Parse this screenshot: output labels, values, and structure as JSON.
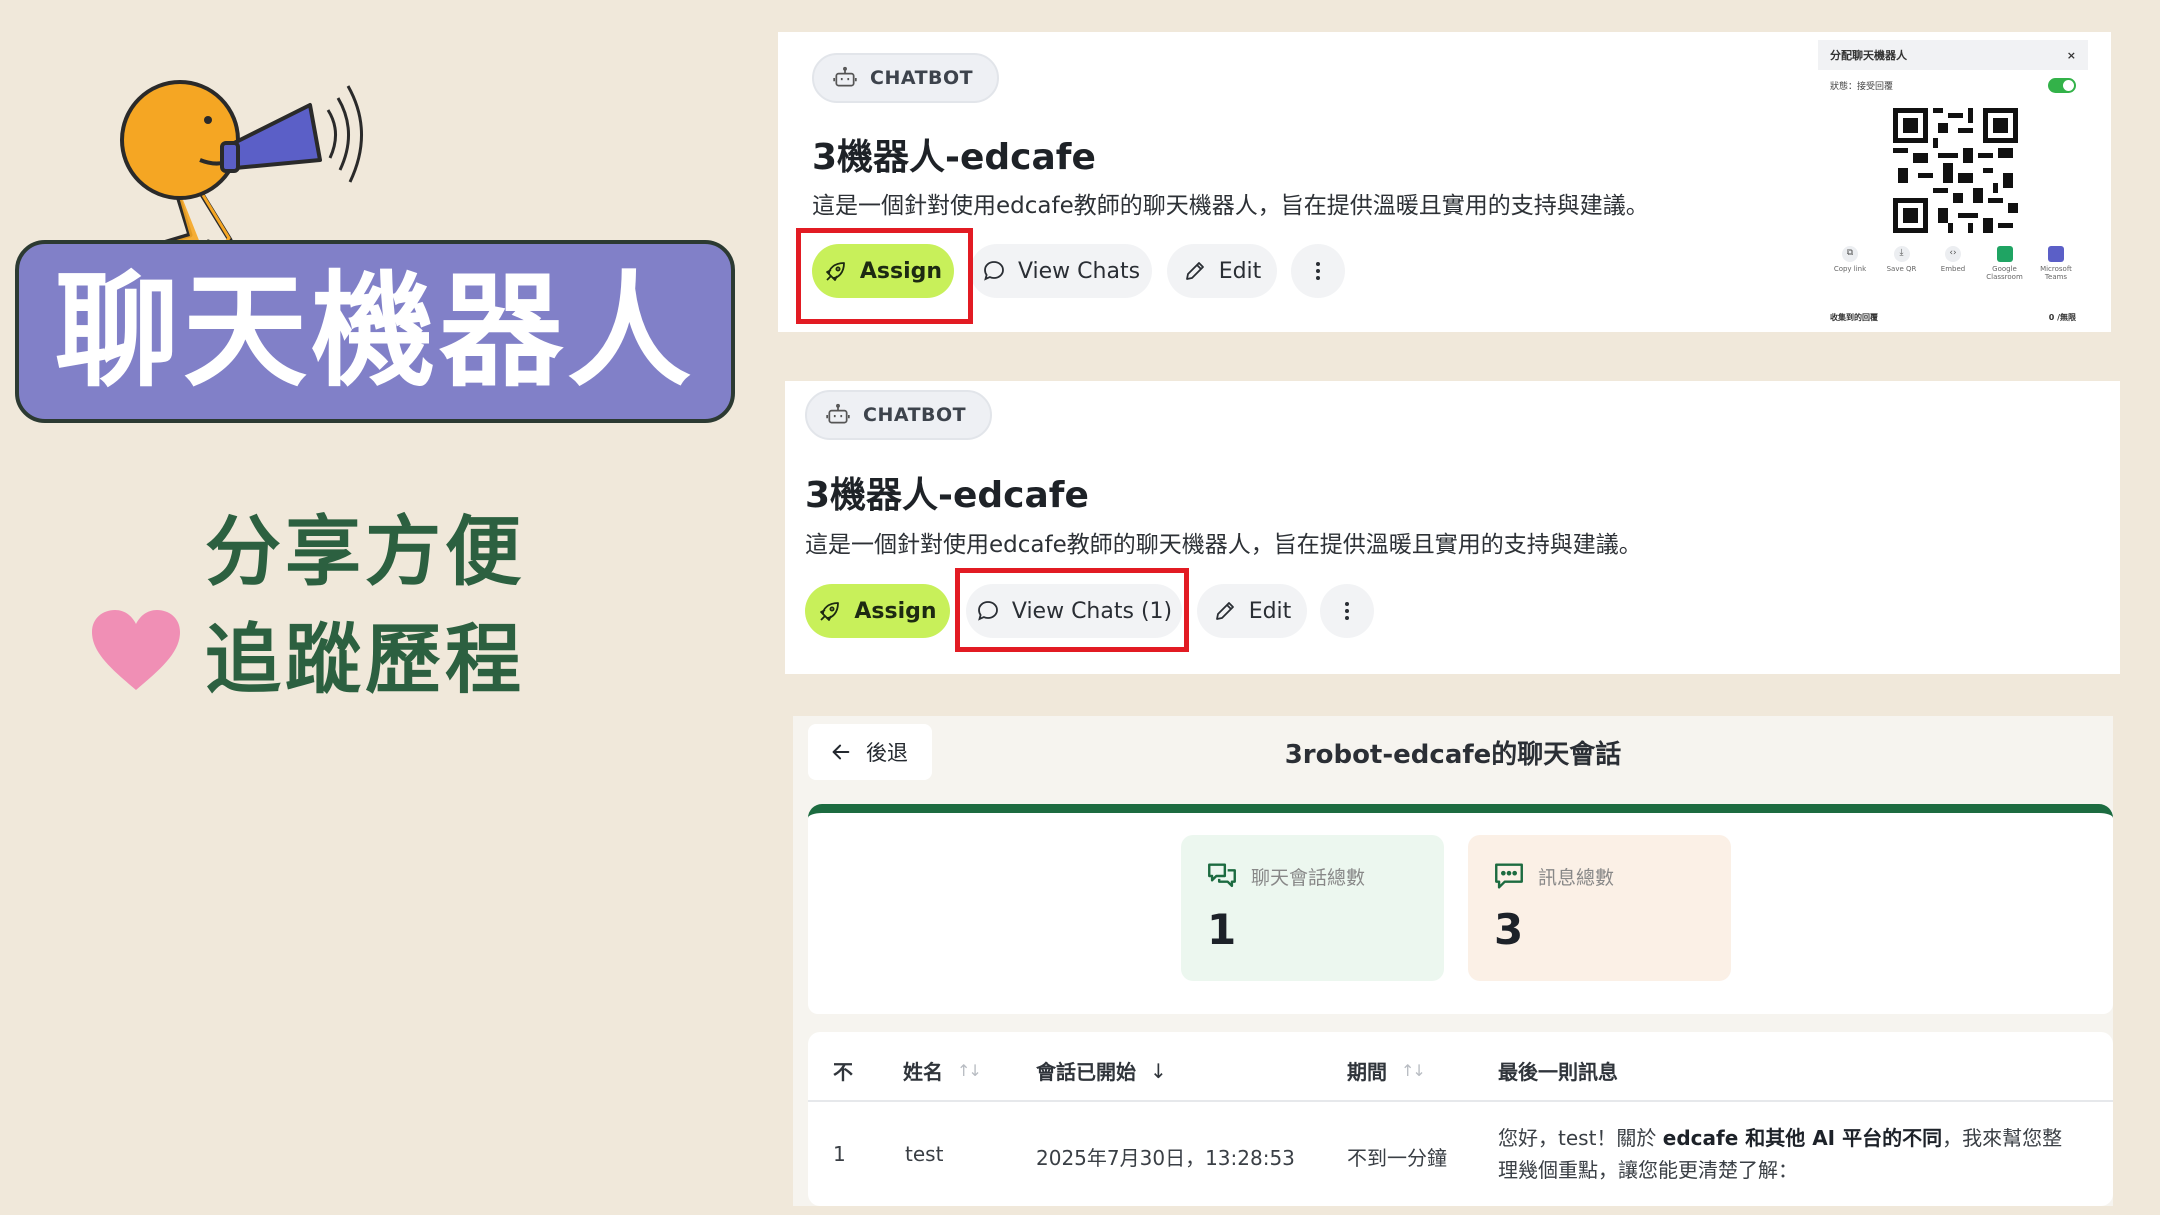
{
  "left": {
    "title": "聊天機器人",
    "features": [
      "分享方便",
      "追蹤歷程"
    ]
  },
  "panel1": {
    "chip_label": "CHATBOT",
    "bot_name": "3機器人-edcafe",
    "description": "這是一個針對使用edcafe教師的聊天機器人，旨在提供溫暖且實用的支持與建議。",
    "buttons": {
      "assign": "Assign",
      "view_chats": "View Chats",
      "edit": "Edit"
    },
    "share_dialog": {
      "title": "分配聊天機器人",
      "close": "×",
      "status_label": "狀態：接受回覆",
      "icons": [
        {
          "label": "Copy link",
          "icon": "link-icon"
        },
        {
          "label": "Save QR",
          "icon": "download-icon"
        },
        {
          "label": "Embed",
          "icon": "code-icon"
        },
        {
          "label": "Google Classroom",
          "icon": "google-classroom-icon"
        },
        {
          "label": "Microsoft Teams",
          "icon": "teams-icon"
        }
      ],
      "footer_left": "收集到的回覆",
      "footer_right": "0 /無限"
    }
  },
  "panel2": {
    "chip_label": "CHATBOT",
    "bot_name": "3機器人-edcafe",
    "description": "這是一個針對使用edcafe教師的聊天機器人，旨在提供溫暖且實用的支持與建議。",
    "buttons": {
      "assign": "Assign",
      "view_chats": "View Chats (1)",
      "edit": "Edit"
    }
  },
  "panel3": {
    "back_label": "後退",
    "title": "3robot-edcafe的聊天會話",
    "stats": [
      {
        "label": "聊天會話總數",
        "value": "1"
      },
      {
        "label": "訊息總數",
        "value": "3"
      }
    ],
    "table": {
      "headers": [
        "不",
        "姓名",
        "會話已開始",
        "期間",
        "最後一則訊息"
      ],
      "rows": [
        {
          "no": "1",
          "name": "test",
          "started": "2025年7月30日，13:28:53",
          "duration": "不到一分鐘",
          "msg_pre": "您好，test！關於 ",
          "msg_bold": "edcafe 和其他 AI 平台的不同",
          "msg_post": "，我來幫您整理幾個重點，讓您能更清楚了解："
        }
      ]
    }
  },
  "colors": {
    "background": "#f0e8da",
    "title_box": "#8180c8",
    "feature_text": "#2c6040",
    "assign_green": "#c8f05a",
    "highlight_red": "#e21b23",
    "stats_bar": "#1c6b40"
  }
}
